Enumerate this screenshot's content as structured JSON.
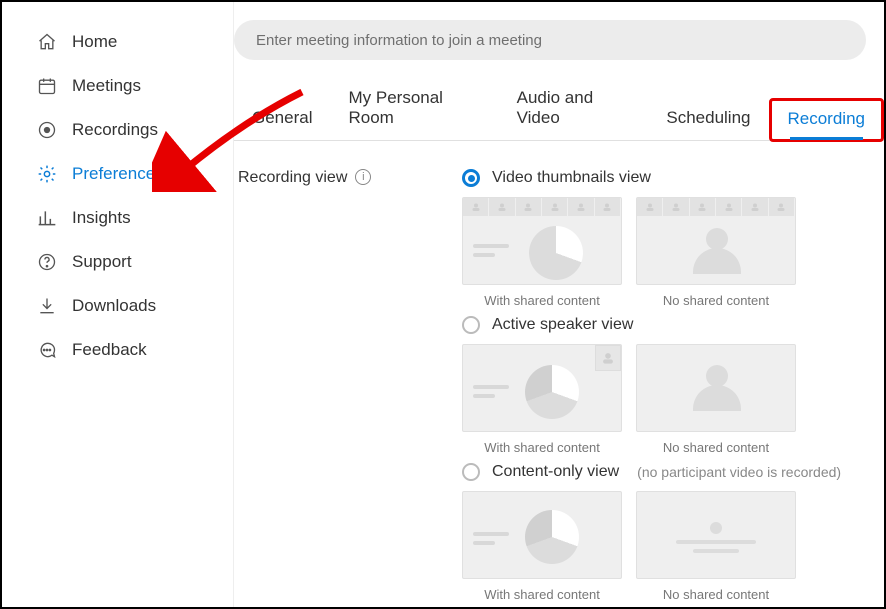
{
  "search": {
    "placeholder": "Enter meeting information to join a meeting"
  },
  "sidebar": {
    "items": [
      {
        "label": "Home"
      },
      {
        "label": "Meetings"
      },
      {
        "label": "Recordings"
      },
      {
        "label": "Preferences"
      },
      {
        "label": "Insights"
      },
      {
        "label": "Support"
      },
      {
        "label": "Downloads"
      },
      {
        "label": "Feedback"
      }
    ]
  },
  "tabs": [
    {
      "label": "General"
    },
    {
      "label": "My Personal Room"
    },
    {
      "label": "Audio and Video"
    },
    {
      "label": "Scheduling"
    },
    {
      "label": "Recording"
    }
  ],
  "section": {
    "label": "Recording view"
  },
  "options": [
    {
      "label": "Video thumbnails view",
      "selected": true,
      "previews": [
        {
          "caption": "With shared content"
        },
        {
          "caption": "No shared content"
        }
      ]
    },
    {
      "label": "Active speaker view",
      "selected": false,
      "previews": [
        {
          "caption": "With shared content"
        },
        {
          "caption": "No shared content"
        }
      ]
    },
    {
      "label": "Content-only view",
      "note": "(no participant video is recorded)",
      "selected": false,
      "previews": [
        {
          "caption": "With shared content"
        },
        {
          "caption": "No shared content"
        }
      ]
    }
  ]
}
